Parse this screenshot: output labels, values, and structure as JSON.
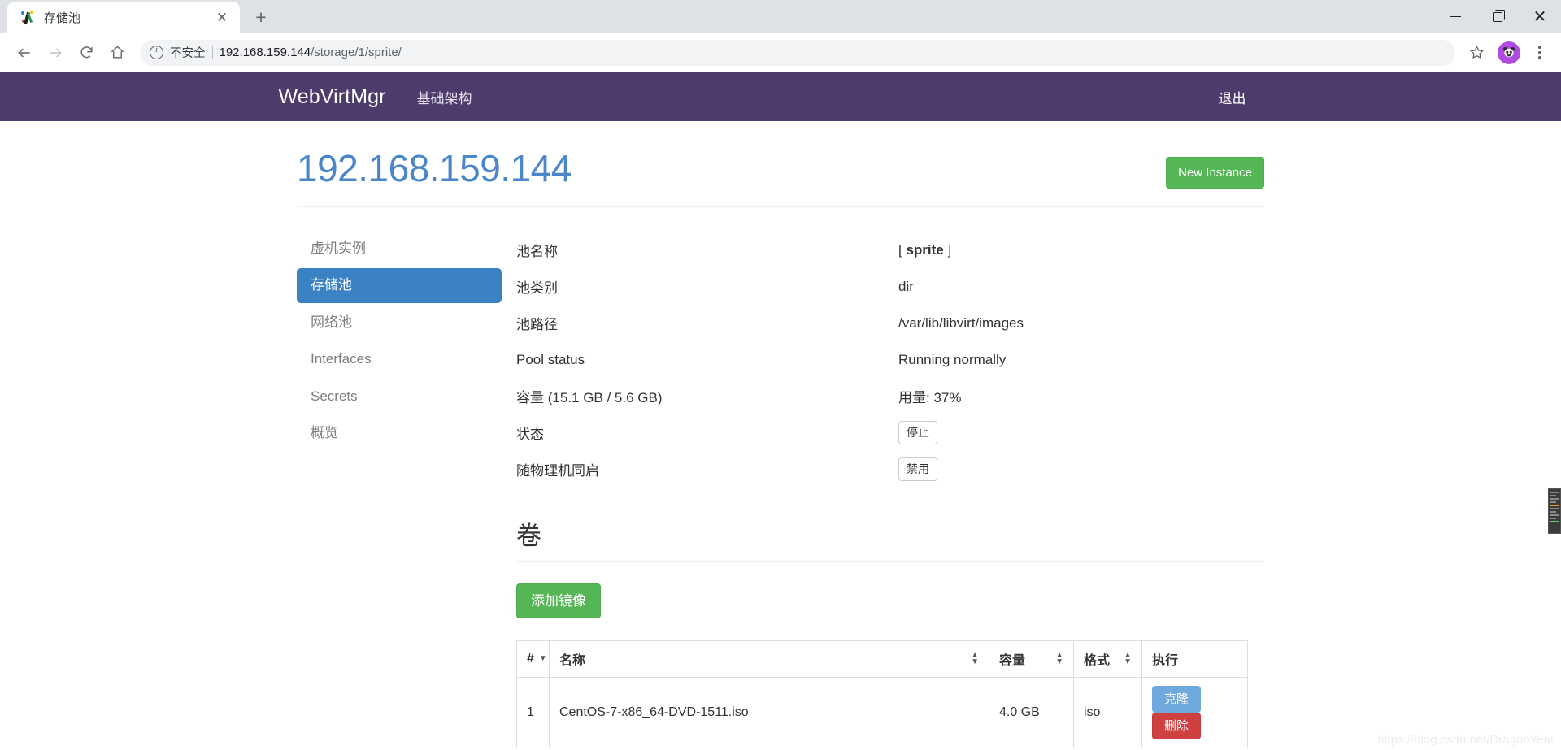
{
  "browser": {
    "tab": {
      "title": "存储池",
      "favicon_icon": "webvirtmgr-favicon",
      "close_icon": "close-icon"
    },
    "new_tab_icon": "plus-icon",
    "window_controls": {
      "minimize_icon": "minimize-icon",
      "maximize_icon": "maximize-icon",
      "close_icon": "window-close-icon"
    },
    "toolbar": {
      "back_icon": "back-arrow-icon",
      "forward_icon": "forward-arrow-icon",
      "reload_icon": "reload-icon",
      "home_icon": "home-icon",
      "security_icon": "info-circle-icon",
      "security_label": "不安全",
      "url_host": "192.168.159.144",
      "url_path": "/storage/1/sprite/",
      "bookmark_icon": "star-icon",
      "profile_icon": "avatar-panda-icon",
      "menu_icon": "three-dot-menu-icon"
    }
  },
  "navbar": {
    "brand": "WebVirtMgr",
    "links": [
      {
        "label": "基础架构"
      }
    ],
    "logout_label": "退出",
    "bg_color": "#4d3c6b"
  },
  "header": {
    "title": "192.168.159.144",
    "title_color": "#4b86c8",
    "new_instance_label": "New Instance",
    "new_instance_color": "#55b655"
  },
  "sidebar": {
    "items": [
      {
        "label": "虚机实例",
        "active": false
      },
      {
        "label": "存储池",
        "active": true
      },
      {
        "label": "网络池",
        "active": false
      },
      {
        "label": "Interfaces",
        "active": false
      },
      {
        "label": "Secrets",
        "active": false
      },
      {
        "label": "概览",
        "active": false
      }
    ],
    "active_color": "#3b82c4"
  },
  "details": {
    "rows": [
      {
        "key": "池名称",
        "value": "[ sprite ]",
        "type": "text-bold"
      },
      {
        "key": "池类别",
        "value": "dir",
        "type": "text"
      },
      {
        "key": "池路径",
        "value": "/var/lib/libvirt/images",
        "type": "text"
      },
      {
        "key": "Pool status",
        "value": "Running normally",
        "type": "text"
      },
      {
        "key": "容量 (15.1 GB / 5.6 GB)",
        "value": "用量: 37%",
        "type": "text"
      },
      {
        "key": "状态",
        "value": "停止",
        "type": "badge"
      },
      {
        "key": "随物理机同启",
        "value": "禁用",
        "type": "badge"
      }
    ]
  },
  "volumes": {
    "section_title": "卷",
    "add_image_label": "添加镜像",
    "columns": [
      {
        "label": "#",
        "sort": "caret"
      },
      {
        "label": "名称",
        "sort": "updown"
      },
      {
        "label": "容量",
        "sort": "updown"
      },
      {
        "label": "格式",
        "sort": "updown"
      },
      {
        "label": "执行",
        "sort": "none"
      }
    ],
    "rows": [
      {
        "num": "1",
        "name": "CentOS-7-x86_64-DVD-1511.iso",
        "size": "4.0 GB",
        "format": "iso",
        "clone_label": "克隆",
        "delete_label": "删除"
      }
    ]
  },
  "watermark": {
    "text": "https://blog.csdn.net/DragonYear"
  }
}
